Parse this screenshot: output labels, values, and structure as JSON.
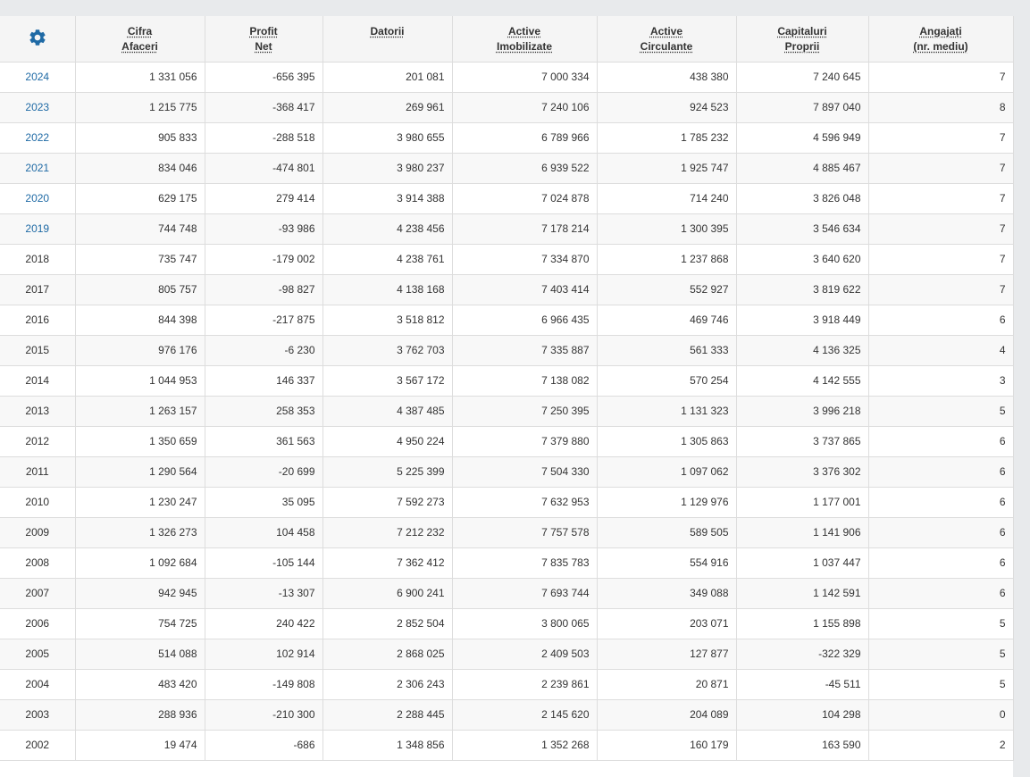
{
  "table": {
    "headers": [
      {
        "line1": "Cifra",
        "line2": "Afaceri"
      },
      {
        "line1": "Profit",
        "line2": "Net"
      },
      {
        "line1": "Datorii",
        "line2": ""
      },
      {
        "line1": "Active",
        "line2": "Imobilizate"
      },
      {
        "line1": "Active",
        "line2": "Circulante"
      },
      {
        "line1": "Capitaluri",
        "line2": "Proprii"
      },
      {
        "line1": "Angajați",
        "line2": "(nr. mediu)"
      }
    ],
    "settings_icon": "gear-icon",
    "settings_color": "#1f6aa5",
    "link_color": "#1f6aa5",
    "rows": [
      {
        "year": "2024",
        "link": true,
        "values": [
          "1 331 056",
          "-656 395",
          "201 081",
          "7 000 334",
          "438 380",
          "7 240 645",
          "7"
        ]
      },
      {
        "year": "2023",
        "link": true,
        "values": [
          "1 215 775",
          "-368 417",
          "269 961",
          "7 240 106",
          "924 523",
          "7 897 040",
          "8"
        ]
      },
      {
        "year": "2022",
        "link": true,
        "values": [
          "905 833",
          "-288 518",
          "3 980 655",
          "6 789 966",
          "1 785 232",
          "4 596 949",
          "7"
        ]
      },
      {
        "year": "2021",
        "link": true,
        "values": [
          "834 046",
          "-474 801",
          "3 980 237",
          "6 939 522",
          "1 925 747",
          "4 885 467",
          "7"
        ]
      },
      {
        "year": "2020",
        "link": true,
        "values": [
          "629 175",
          "279 414",
          "3 914 388",
          "7 024 878",
          "714 240",
          "3 826 048",
          "7"
        ]
      },
      {
        "year": "2019",
        "link": true,
        "values": [
          "744 748",
          "-93 986",
          "4 238 456",
          "7 178 214",
          "1 300 395",
          "3 546 634",
          "7"
        ]
      },
      {
        "year": "2018",
        "link": false,
        "values": [
          "735 747",
          "-179 002",
          "4 238 761",
          "7 334 870",
          "1 237 868",
          "3 640 620",
          "7"
        ]
      },
      {
        "year": "2017",
        "link": false,
        "values": [
          "805 757",
          "-98 827",
          "4 138 168",
          "7 403 414",
          "552 927",
          "3 819 622",
          "7"
        ]
      },
      {
        "year": "2016",
        "link": false,
        "values": [
          "844 398",
          "-217 875",
          "3 518 812",
          "6 966 435",
          "469 746",
          "3 918 449",
          "6"
        ]
      },
      {
        "year": "2015",
        "link": false,
        "values": [
          "976 176",
          "-6 230",
          "3 762 703",
          "7 335 887",
          "561 333",
          "4 136 325",
          "4"
        ]
      },
      {
        "year": "2014",
        "link": false,
        "values": [
          "1 044 953",
          "146 337",
          "3 567 172",
          "7 138 082",
          "570 254",
          "4 142 555",
          "3"
        ]
      },
      {
        "year": "2013",
        "link": false,
        "values": [
          "1 263 157",
          "258 353",
          "4 387 485",
          "7 250 395",
          "1 131 323",
          "3 996 218",
          "5"
        ]
      },
      {
        "year": "2012",
        "link": false,
        "values": [
          "1 350 659",
          "361 563",
          "4 950 224",
          "7 379 880",
          "1 305 863",
          "3 737 865",
          "6"
        ]
      },
      {
        "year": "2011",
        "link": false,
        "values": [
          "1 290 564",
          "-20 699",
          "5 225 399",
          "7 504 330",
          "1 097 062",
          "3 376 302",
          "6"
        ]
      },
      {
        "year": "2010",
        "link": false,
        "values": [
          "1 230 247",
          "35 095",
          "7 592 273",
          "7 632 953",
          "1 129 976",
          "1 177 001",
          "6"
        ]
      },
      {
        "year": "2009",
        "link": false,
        "values": [
          "1 326 273",
          "104 458",
          "7 212 232",
          "7 757 578",
          "589 505",
          "1 141 906",
          "6"
        ]
      },
      {
        "year": "2008",
        "link": false,
        "values": [
          "1 092 684",
          "-105 144",
          "7 362 412",
          "7 835 783",
          "554 916",
          "1 037 447",
          "6"
        ]
      },
      {
        "year": "2007",
        "link": false,
        "values": [
          "942 945",
          "-13 307",
          "6 900 241",
          "7 693 744",
          "349 088",
          "1 142 591",
          "6"
        ]
      },
      {
        "year": "2006",
        "link": false,
        "values": [
          "754 725",
          "240 422",
          "2 852 504",
          "3 800 065",
          "203 071",
          "1 155 898",
          "5"
        ]
      },
      {
        "year": "2005",
        "link": false,
        "values": [
          "514 088",
          "102 914",
          "2 868 025",
          "2 409 503",
          "127 877",
          "-322 329",
          "5"
        ]
      },
      {
        "year": "2004",
        "link": false,
        "values": [
          "483 420",
          "-149 808",
          "2 306 243",
          "2 239 861",
          "20 871",
          "-45 511",
          "5"
        ]
      },
      {
        "year": "2003",
        "link": false,
        "values": [
          "288 936",
          "-210 300",
          "2 288 445",
          "2 145 620",
          "204 089",
          "104 298",
          "0"
        ]
      },
      {
        "year": "2002",
        "link": false,
        "values": [
          "19 474",
          "-686",
          "1 348 856",
          "1 352 268",
          "160 179",
          "163 590",
          "2"
        ]
      }
    ]
  }
}
